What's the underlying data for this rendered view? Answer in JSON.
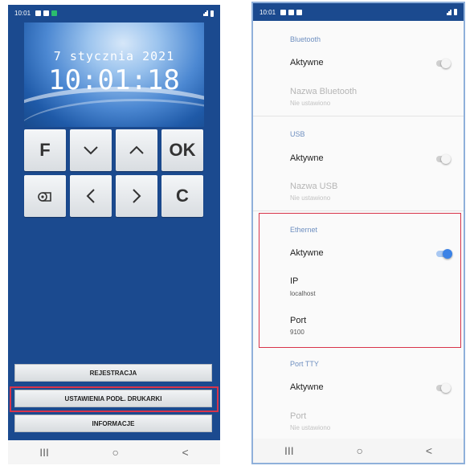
{
  "left_phone": {
    "status_time": "10:01",
    "clock": {
      "date": "7 stycznia 2021",
      "time": "10:01:18"
    },
    "keypad": {
      "f": "F",
      "ok": "OK",
      "c": "C"
    },
    "menu": {
      "registration": "REJESTRACJA",
      "printer_settings": "USTAWIENIA PODŁ. DRUKARKI",
      "information": "INFORMACJE"
    },
    "nav": {
      "recent": "III",
      "home": "○",
      "back": "<"
    }
  },
  "right_phone": {
    "status_time": "10:01",
    "bluetooth": {
      "section": "Bluetooth",
      "active_label": "Aktywne",
      "active": false,
      "name_label": "Nazwa Bluetooth",
      "name_value": "Nie ustawiono"
    },
    "usb": {
      "section": "USB",
      "active_label": "Aktywne",
      "active": false,
      "name_label": "Nazwa USB",
      "name_value": "Nie ustawiono"
    },
    "ethernet": {
      "section": "Ethernet",
      "active_label": "Aktywne",
      "active": true,
      "ip_label": "IP",
      "ip_value": "localhost",
      "port_label": "Port",
      "port_value": "9100"
    },
    "tty": {
      "section": "Port TTY",
      "active_label": "Aktywne",
      "active": false,
      "port_label": "Port",
      "port_value": "Nie ustawiono"
    },
    "nav": {
      "recent": "III",
      "home": "○",
      "back": "<"
    }
  },
  "colors": {
    "app_blue": "#1b4a8f",
    "highlight_red": "#d8344a",
    "section_blue": "#6e8fc0",
    "toggle_on": "#3b82e6"
  }
}
